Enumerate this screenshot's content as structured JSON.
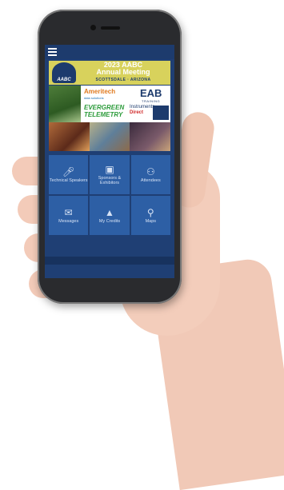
{
  "banner": {
    "logo_text": "AABC",
    "title_line1": "2023 AABC",
    "title_line2": "Annual Meeting",
    "subtitle": "SCOTTSDALE · ARIZONA"
  },
  "sponsors": {
    "ameritech": "Ameritech",
    "ameritech_sub": "data solutions",
    "eab": "EAB",
    "eab_sub": "TRAINING",
    "evergreen_1": "EVERGREEN",
    "evergreen_2": "TELEMETRY",
    "instruments_1": "Instruments",
    "instruments_2": "Direct"
  },
  "menu_tiles": [
    {
      "icon": "microphone-icon",
      "label": "Technical Speakers"
    },
    {
      "icon": "presentation-icon",
      "label": "Sponsors & Exhibitors"
    },
    {
      "icon": "people-icon",
      "label": "Attendees"
    },
    {
      "icon": "envelope-icon",
      "label": "Messages"
    },
    {
      "icon": "graduation-cap-icon",
      "label": "My Credits"
    },
    {
      "icon": "map-pin-icon",
      "label": "Maps"
    }
  ]
}
